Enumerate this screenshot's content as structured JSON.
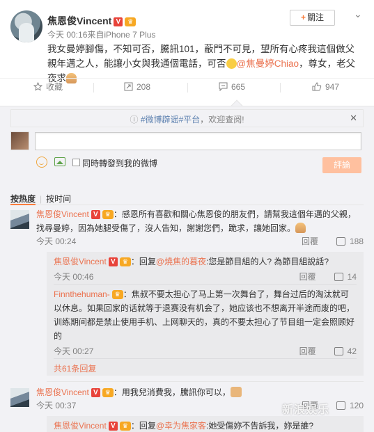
{
  "post": {
    "username": "焦恩俊Vincent",
    "vip_badge": "V",
    "follow_label": "關注",
    "meta": "今天 00:16来自iPhone 7 Plus",
    "text_part1": "我女曼婷腳傷，不知可否，騰訊101，蔽門不可見，望所有心疼我這個做父親年邁之人，能讓小女與我通個電話，可否",
    "mention": "@焦曼婷Chiao",
    "text_part2": "，尊女，老父夜求"
  },
  "actions": {
    "favorite": "收藏",
    "repost": "208",
    "comment": "665",
    "like": "947"
  },
  "comments_panel": {
    "notice_tag": "#微博辟谣#平台",
    "notice_text": "欢迎查阅!",
    "repost_option": "同時轉發到我的微博",
    "submit": "評論",
    "sort_hot": "按热度",
    "sort_time": "按时间"
  },
  "comments": [
    {
      "name": "焦恩俊Vincent",
      "text": "：感恩所有喜歡和關心焦恩俊的朋友們，請幫我這個年邁的父親，找尋曼婷，因為她腿受傷了，沒人告知，謝謝您們，跪求，讓她回家。",
      "time": "今天 00:24",
      "reply_label": "回覆",
      "likes": "188",
      "replies": [
        {
          "name": "焦恩俊Vincent",
          "prefix": "：回复",
          "mention": "@燒焦的暮夜",
          "text": ":您是節目組的人? 為節目組說話?",
          "time": "今天 00:46",
          "reply_label": "回覆",
          "likes": "14"
        },
        {
          "name": "Finnthehuman-",
          "text": "：焦叔不要太担心了马上第一次舞台了，舞台过后的淘汰就可以休息。如果回家的话就等于退赛没有机会了，她应该也不想离开半途而废的吧，训练期间都是禁止使用手机、上网聊天的，真的不要太担心了节目组一定会照顾好的",
          "time": "今天 00:27",
          "reply_label": "回覆",
          "likes": "42"
        }
      ],
      "more": "共61条回复"
    },
    {
      "name": "焦恩俊Vincent",
      "text": "：用我兒消費我，騰訊你可以，",
      "time": "今天 00:37",
      "reply_label": "回覆",
      "likes": "120",
      "replies": [
        {
          "name": "焦恩俊Vincent",
          "prefix": "：回复",
          "mention": "@幸为焦家客",
          "text": ":她受傷妳不告訴我，妳是誰?"
        }
      ]
    }
  ],
  "watermark": "新浪娱乐",
  "colors": {
    "accent": "#eb7350",
    "orange": "#fa7d3c",
    "link_blue": "#5a7fae"
  }
}
